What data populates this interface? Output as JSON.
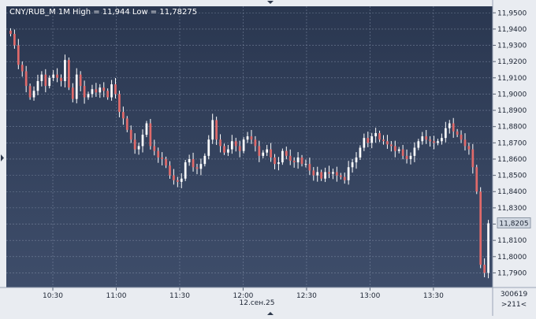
{
  "header": {
    "label": "CNY/RUB_M 1M High = 11,944 Low = 11,78275"
  },
  "colors": {
    "background_top": "#2a3750",
    "background_bottom": "#3e4d6a",
    "grid": "#8d9ab2",
    "candle_up": "#ffffff",
    "candle_down": "#e06a6a",
    "axis_panel": "#e9ecf1",
    "price_marker": "#cfd6e0"
  },
  "chart_data": {
    "type": "candlestick",
    "title": "CNY/RUB_M 1M",
    "high": "11,944",
    "low": "11,78275",
    "ylim": [
      11.781,
      11.954
    ],
    "xlim": [
      "10:08",
      "13:58"
    ],
    "y_ticks": [
      "11,9500",
      "11,9400",
      "11,9300",
      "11,9200",
      "11,9100",
      "11,9000",
      "11,8900",
      "11,8800",
      "11,8700",
      "11,8600",
      "11,8500",
      "11,8400",
      "11,8300",
      "11,8200",
      "11,8100",
      "11,8000",
      "11,7900"
    ],
    "x_ticks": [
      "10:30",
      "11:00",
      "11:30",
      "12:00",
      "12:30",
      "13:00",
      "13:30"
    ],
    "date_label": "12.сен.25",
    "last_price": "11,8205",
    "corner_top": "300619",
    "corner_bottom": ">211<",
    "grid": true,
    "close_series": [
      11.937,
      11.93,
      11.918,
      11.914,
      11.905,
      11.898,
      11.902,
      11.908,
      11.912,
      11.905,
      11.91,
      11.912,
      11.91,
      11.908,
      11.921,
      11.904,
      11.897,
      11.912,
      11.905,
      11.898,
      11.9,
      11.903,
      11.901,
      11.904,
      11.902,
      11.898,
      11.906,
      11.9,
      11.889,
      11.885,
      11.878,
      11.872,
      11.866,
      11.868,
      11.875,
      11.882,
      11.868,
      11.865,
      11.861,
      11.86,
      11.856,
      11.85,
      11.847,
      11.846,
      11.848,
      11.858,
      11.86,
      11.855,
      11.854,
      11.857,
      11.862,
      11.872,
      11.884,
      11.872,
      11.868,
      11.864,
      11.866,
      11.871,
      11.868,
      11.865,
      11.872,
      11.874,
      11.872,
      11.868,
      11.862,
      11.864,
      11.866,
      11.861,
      11.857,
      11.858,
      11.865,
      11.862,
      11.859,
      11.858,
      11.861,
      11.857,
      11.857,
      11.853,
      11.85,
      11.852,
      11.848,
      11.852,
      11.851,
      11.852,
      11.85,
      11.849,
      11.847,
      11.855,
      11.858,
      11.861,
      11.867,
      11.873,
      11.87,
      11.874,
      11.876,
      11.872,
      11.871,
      11.869,
      11.868,
      11.865,
      11.866,
      11.862,
      11.86,
      11.862,
      11.867,
      11.871,
      11.874,
      11.872,
      11.871,
      11.87,
      11.871,
      11.873,
      11.879,
      11.882,
      11.877,
      11.875,
      11.872,
      11.868,
      11.866,
      11.855,
      11.84,
      11.795,
      11.79,
      11.8205
    ]
  }
}
